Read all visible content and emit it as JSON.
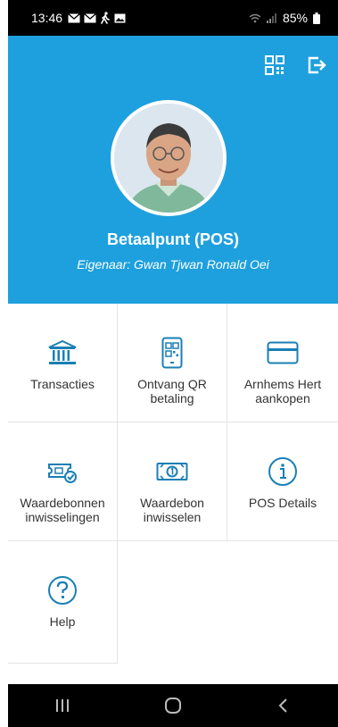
{
  "statusbar": {
    "time": "13:46",
    "battery": "85%"
  },
  "header": {
    "title": "Betaalpunt (POS)",
    "owner": "Eigenaar: Gwan Tjwan Ronald Oei",
    "qr_icon": "qr-code-icon",
    "logout_icon": "logout-icon",
    "background_color": "#1ea0de"
  },
  "tiles": [
    {
      "label": "Transacties",
      "icon": "bank-icon"
    },
    {
      "label": "Ontvang QR betaling",
      "icon": "qr-phone-icon"
    },
    {
      "label": "Arnhems Hert aankopen",
      "icon": "credit-card-icon"
    },
    {
      "label": "Waardebonnen inwisselingen",
      "icon": "voucher-check-icon"
    },
    {
      "label": "Waardebon inwisselen",
      "icon": "banknote-icon"
    },
    {
      "label": "POS Details",
      "icon": "info-icon"
    },
    {
      "label": "Help",
      "icon": "help-icon"
    }
  ],
  "accent_color": "#1a7fb5"
}
